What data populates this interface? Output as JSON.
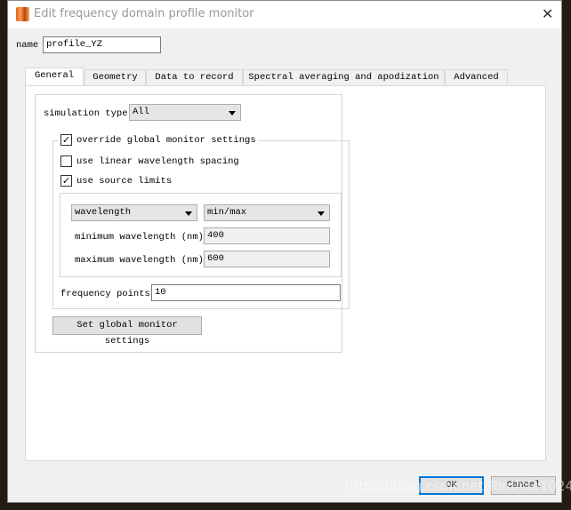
{
  "window": {
    "title": "Edit frequency domain profile monitor",
    "close_icon": "close-icon",
    "logo_icon": "lumerical-logo-icon"
  },
  "name": {
    "label": "name",
    "value": "profile_YZ"
  },
  "tabs": [
    {
      "label": "General",
      "active": true
    },
    {
      "label": "Geometry"
    },
    {
      "label": "Data to record"
    },
    {
      "label": "Spectral averaging and apodization"
    },
    {
      "label": "Advanced"
    }
  ],
  "general": {
    "simulation_type": {
      "label": "simulation type",
      "value": "All"
    },
    "override": {
      "label": "override global monitor settings",
      "checked": true
    },
    "linear_spacing": {
      "label": "use linear wavelength spacing",
      "checked": false
    },
    "source_limits": {
      "label": "use source limits",
      "checked": true
    },
    "range_type": "wavelength",
    "range_mode": "min/max",
    "min_wavelength": {
      "label": "minimum wavelength (nm)",
      "value": "400"
    },
    "max_wavelength": {
      "label": "maximum wavelength (nm)",
      "value": "600"
    },
    "frequency_points": {
      "label": "frequency points",
      "value": "10"
    },
    "set_global_label": "Set global monitor settings"
  },
  "buttons": {
    "ok": "OK",
    "cancel": "Cancel"
  },
  "watermark": "https://blog.csdn.net/Tommie1024"
}
